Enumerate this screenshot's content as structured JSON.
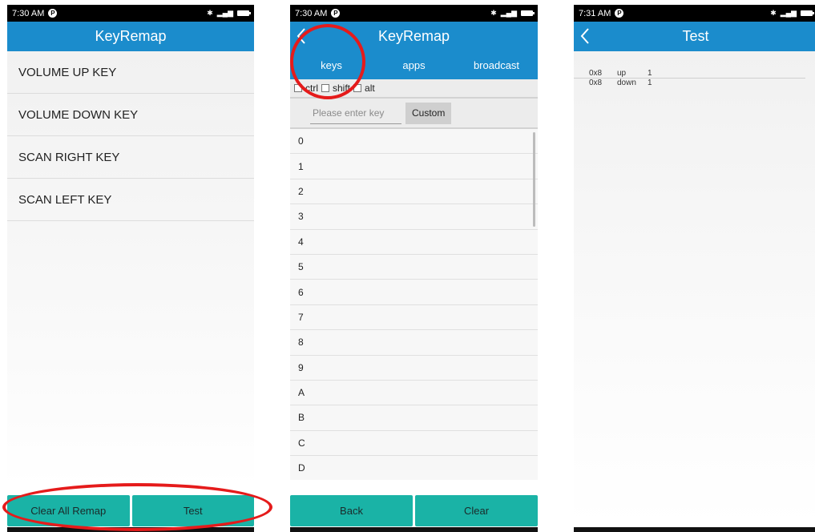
{
  "colors": {
    "header": "#1b8ccc",
    "button": "#1ab3a6",
    "annotation": "#e51b1b"
  },
  "screen1": {
    "status_time": "7:30 AM",
    "title": "KeyRemap",
    "keys": [
      "VOLUME UP KEY",
      "VOLUME DOWN KEY",
      "SCAN RIGHT KEY",
      "SCAN LEFT KEY"
    ],
    "clear_all_label": "Clear All Remap",
    "test_label": "Test"
  },
  "screen2": {
    "status_time": "7:30 AM",
    "title": "KeyRemap",
    "back_icon": "chevron-left-icon",
    "tabs": [
      "keys",
      "apps",
      "broadcast"
    ],
    "modifiers": [
      "ctrl",
      "shift",
      "alt"
    ],
    "input_placeholder": "Please enter key",
    "custom_label": "Custom",
    "key_list": [
      "0",
      "1",
      "2",
      "3",
      "4",
      "5",
      "6",
      "7",
      "8",
      "9",
      "A",
      "B",
      "C",
      "D"
    ],
    "back_label": "Back",
    "clear_label": "Clear"
  },
  "screen3": {
    "status_time": "7:31 AM",
    "title": "Test",
    "back_icon": "chevron-left-icon",
    "log": [
      {
        "code": "0x8",
        "dir": "up",
        "val": "1"
      },
      {
        "code": "0x8",
        "dir": "down",
        "val": "1"
      }
    ]
  }
}
